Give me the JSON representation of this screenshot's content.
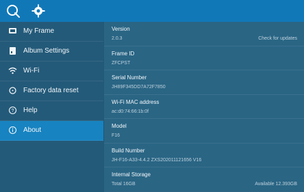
{
  "topbar": {
    "icons": [
      {
        "name": "back-logo-icon"
      },
      {
        "name": "gear-icon"
      }
    ]
  },
  "sidebar": {
    "items": [
      {
        "label": "My Frame",
        "icon": "frame-icon",
        "active": false
      },
      {
        "label": "Album Settings",
        "icon": "album-icon",
        "active": false
      },
      {
        "label": "Wi-Fi",
        "icon": "wifi-icon",
        "active": false
      },
      {
        "label": "Factory data reset",
        "icon": "reset-icon",
        "active": false
      },
      {
        "label": "Help",
        "icon": "help-icon",
        "active": false
      },
      {
        "label": "About",
        "icon": "info-icon",
        "active": true
      }
    ]
  },
  "about": {
    "version": {
      "title": "Version",
      "value": "2.0.3",
      "action": "Check for updates"
    },
    "frame_id": {
      "title": "Frame ID",
      "value": "ZFCPST"
    },
    "serial": {
      "title": "Serial Number",
      "value": "JH89F345DD7A72F7850"
    },
    "wifi_mac": {
      "title": "Wi-Fi MAC address",
      "value": "ac:d0:74:66:1b:0f"
    },
    "model": {
      "title": "Model",
      "value": "F16"
    },
    "build": {
      "title": "Build Number",
      "value": "JH-F16-A33-4.4.2 ZXS202011121656 V16"
    },
    "storage": {
      "title": "Internal Storage",
      "total": "Total 16GB",
      "available": "Available 12.393GB"
    }
  },
  "colors": {
    "topbar": "#1178b8",
    "sidebar": "#245a79",
    "active": "#1783c0",
    "content": "#2a6584"
  }
}
